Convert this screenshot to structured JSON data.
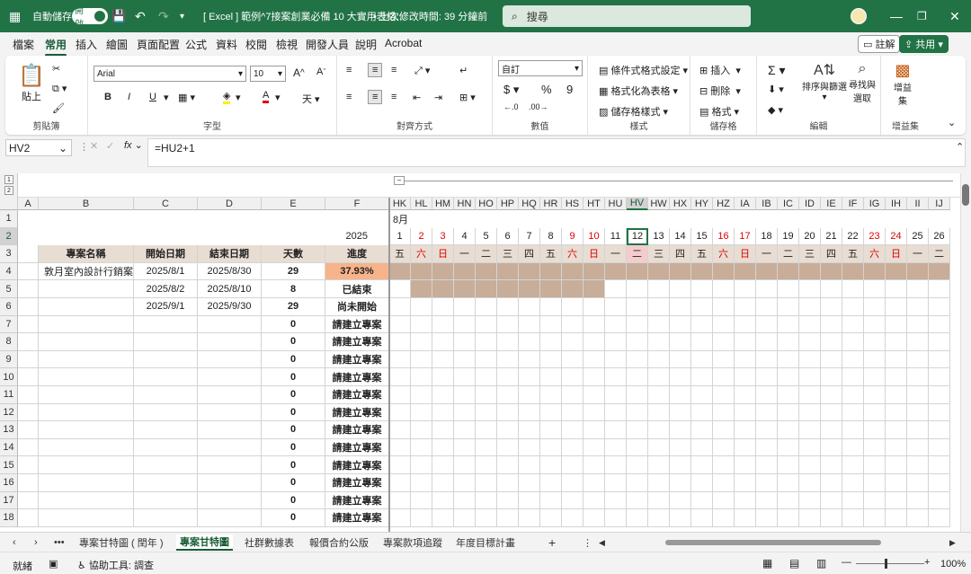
{
  "titlebar": {
    "autosave": "自動儲存",
    "toggle": "開啟",
    "doc_title": "[ Excel ] 範例^7接案創業必備 10 大實用表格...",
    "saved_status": "• 上次修改時間: 39 分鐘前",
    "search_placeholder": "搜尋"
  },
  "menu": {
    "tabs": [
      "檔案",
      "常用",
      "插入",
      "繪圖",
      "頁面配置",
      "公式",
      "資料",
      "校閱",
      "檢視",
      "開發人員",
      "說明",
      "Acrobat"
    ],
    "active": "常用",
    "comment": "註解",
    "share": "共用"
  },
  "ribbon": {
    "paste": "貼上",
    "clipboard": "剪貼簿",
    "font_name": "Arial",
    "font_size": "10",
    "font_group": "字型",
    "bold": "B",
    "italic": "I",
    "underline": "U",
    "align_group": "對齊方式",
    "number_format": "自訂",
    "number_group": "數值",
    "cond_format": "條件式格式設定",
    "format_table": "格式化為表格",
    "cell_styles": "儲存格樣式",
    "style_group": "樣式",
    "insert": "插入",
    "delete": "刪除",
    "format": "格式",
    "cells_group": "儲存格",
    "sort_filter": "排序與篩選",
    "find_select": "尋找與選取",
    "edit_group": "編輯",
    "addins": "增益集",
    "addins_group": "增益集"
  },
  "formula": {
    "namebox": "HV2",
    "content": "=HU2+1"
  },
  "columns_left": [
    "A",
    "B",
    "C",
    "D",
    "E",
    "F"
  ],
  "columns_right": [
    "HK",
    "HL",
    "HM",
    "HN",
    "HO",
    "HP",
    "HQ",
    "HR",
    "HS",
    "HT",
    "HU",
    "HV",
    "HW",
    "HX",
    "HY",
    "HZ",
    "IA",
    "IB",
    "IC",
    "ID",
    "IE",
    "IF",
    "IG",
    "IH",
    "II",
    "IJ"
  ],
  "year": "2025",
  "month": "8月",
  "days": [
    "1",
    "2",
    "3",
    "4",
    "5",
    "6",
    "7",
    "8",
    "9",
    "10",
    "11",
    "12",
    "13",
    "14",
    "15",
    "16",
    "17",
    "18",
    "19",
    "20",
    "21",
    "22",
    "23",
    "24",
    "25",
    "26"
  ],
  "weekdays": [
    "五",
    "六",
    "日",
    "一",
    "二",
    "三",
    "四",
    "五",
    "六",
    "日",
    "一",
    "二",
    "三",
    "四",
    "五",
    "六",
    "日",
    "一",
    "二",
    "三",
    "四",
    "五",
    "六",
    "日",
    "一",
    "二"
  ],
  "headers": {
    "name": "專案名稱",
    "start": "開始日期",
    "end": "結束日期",
    "days": "天數",
    "progress": "進度"
  },
  "rows": [
    {
      "name": "敦月室內設計行銷案",
      "start": "2025/8/1",
      "end": "2025/8/30",
      "days": "29",
      "progress": "37.93%"
    },
    {
      "name": "",
      "start": "2025/8/2",
      "end": "2025/8/10",
      "days": "8",
      "progress": "已結束"
    },
    {
      "name": "",
      "start": "2025/9/1",
      "end": "2025/9/30",
      "days": "29",
      "progress": "尚未開始"
    },
    {
      "name": "",
      "start": "",
      "end": "",
      "days": "0",
      "progress": "請建立專案"
    },
    {
      "name": "",
      "start": "",
      "end": "",
      "days": "0",
      "progress": "請建立專案"
    },
    {
      "name": "",
      "start": "",
      "end": "",
      "days": "0",
      "progress": "請建立專案"
    },
    {
      "name": "",
      "start": "",
      "end": "",
      "days": "0",
      "progress": "請建立專案"
    },
    {
      "name": "",
      "start": "",
      "end": "",
      "days": "0",
      "progress": "請建立專案"
    },
    {
      "name": "",
      "start": "",
      "end": "",
      "days": "0",
      "progress": "請建立專案"
    },
    {
      "name": "",
      "start": "",
      "end": "",
      "days": "0",
      "progress": "請建立專案"
    },
    {
      "name": "",
      "start": "",
      "end": "",
      "days": "0",
      "progress": "請建立專案"
    },
    {
      "name": "",
      "start": "",
      "end": "",
      "days": "0",
      "progress": "請建立專案"
    },
    {
      "name": "",
      "start": "",
      "end": "",
      "days": "0",
      "progress": "請建立專案"
    },
    {
      "name": "",
      "start": "",
      "end": "",
      "days": "0",
      "progress": "請建立專案"
    },
    {
      "name": "",
      "start": "",
      "end": "",
      "days": "0",
      "progress": "請建立專案"
    }
  ],
  "row_numbers": [
    "1",
    "2",
    "3",
    "4",
    "5",
    "6",
    "7",
    "8",
    "9",
    "10",
    "11",
    "12",
    "13",
    "14",
    "15",
    "16",
    "17",
    "18"
  ],
  "sheets": [
    "專案甘特圖 ( 閏年 )",
    "專案甘特圖",
    "社群數據表",
    "報價合約公版",
    "專案款項追蹤",
    "年度目標計畫"
  ],
  "active_sheet": "專案甘特圖",
  "status": {
    "ready": "就緒",
    "accessibility": "協助工具: 調查",
    "zoom": "100%"
  },
  "colors": {
    "accent": "#217346",
    "bar": "#c8ad98",
    "weekend": "#e00000",
    "progress_bg": "#f7b38a",
    "selected_day_bg": "#f4cccc"
  }
}
